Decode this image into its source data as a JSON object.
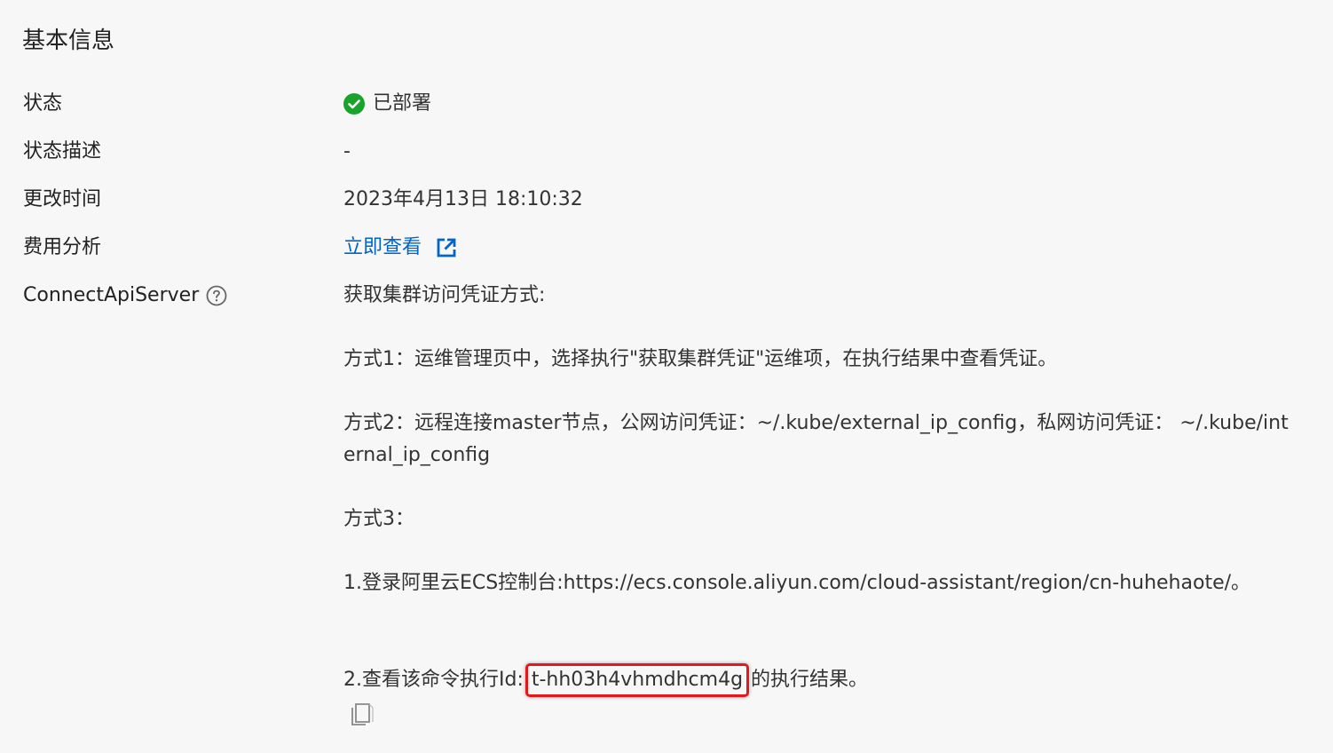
{
  "section": {
    "title": "基本信息"
  },
  "rows": {
    "status": {
      "label": "状态",
      "value": "已部署",
      "color": "#19a22c"
    },
    "status_desc": {
      "label": "状态描述",
      "value": "-"
    },
    "updated": {
      "label": "更改时间",
      "value": "2023年4月13日 18:10:32"
    },
    "cost": {
      "label": "费用分析",
      "link": "立即查看"
    },
    "api": {
      "label": "ConnectApiServer",
      "intro": "获取集群访问凭证方式:",
      "method1": "方式1：运维管理页中，选择执行\"获取集群凭证\"运维项，在执行结果中查看凭证。",
      "method2": "方式2：远程连接master节点，公网访问凭证：~/.kube/external_ip_config，私网访问凭证： ~/.kube/internal_ip_config",
      "method3": "方式3：",
      "step1": "1.登录阿里云ECS控制台:https://ecs.console.aliyun.com/cloud-assistant/region/cn-huhehaote/。",
      "step2_prefix": "2.查看该命令执行Id:",
      "command_id": "t-hh03h4vhmdhcm4g",
      "step2_suffix": "的执行结果。"
    }
  },
  "icons": {
    "status": "check-circle-icon",
    "external": "external-link-icon",
    "help": "question-circle-icon",
    "copy": "copy-icon"
  },
  "colors": {
    "link": "#0064c8",
    "highlight": "#e5171c"
  }
}
